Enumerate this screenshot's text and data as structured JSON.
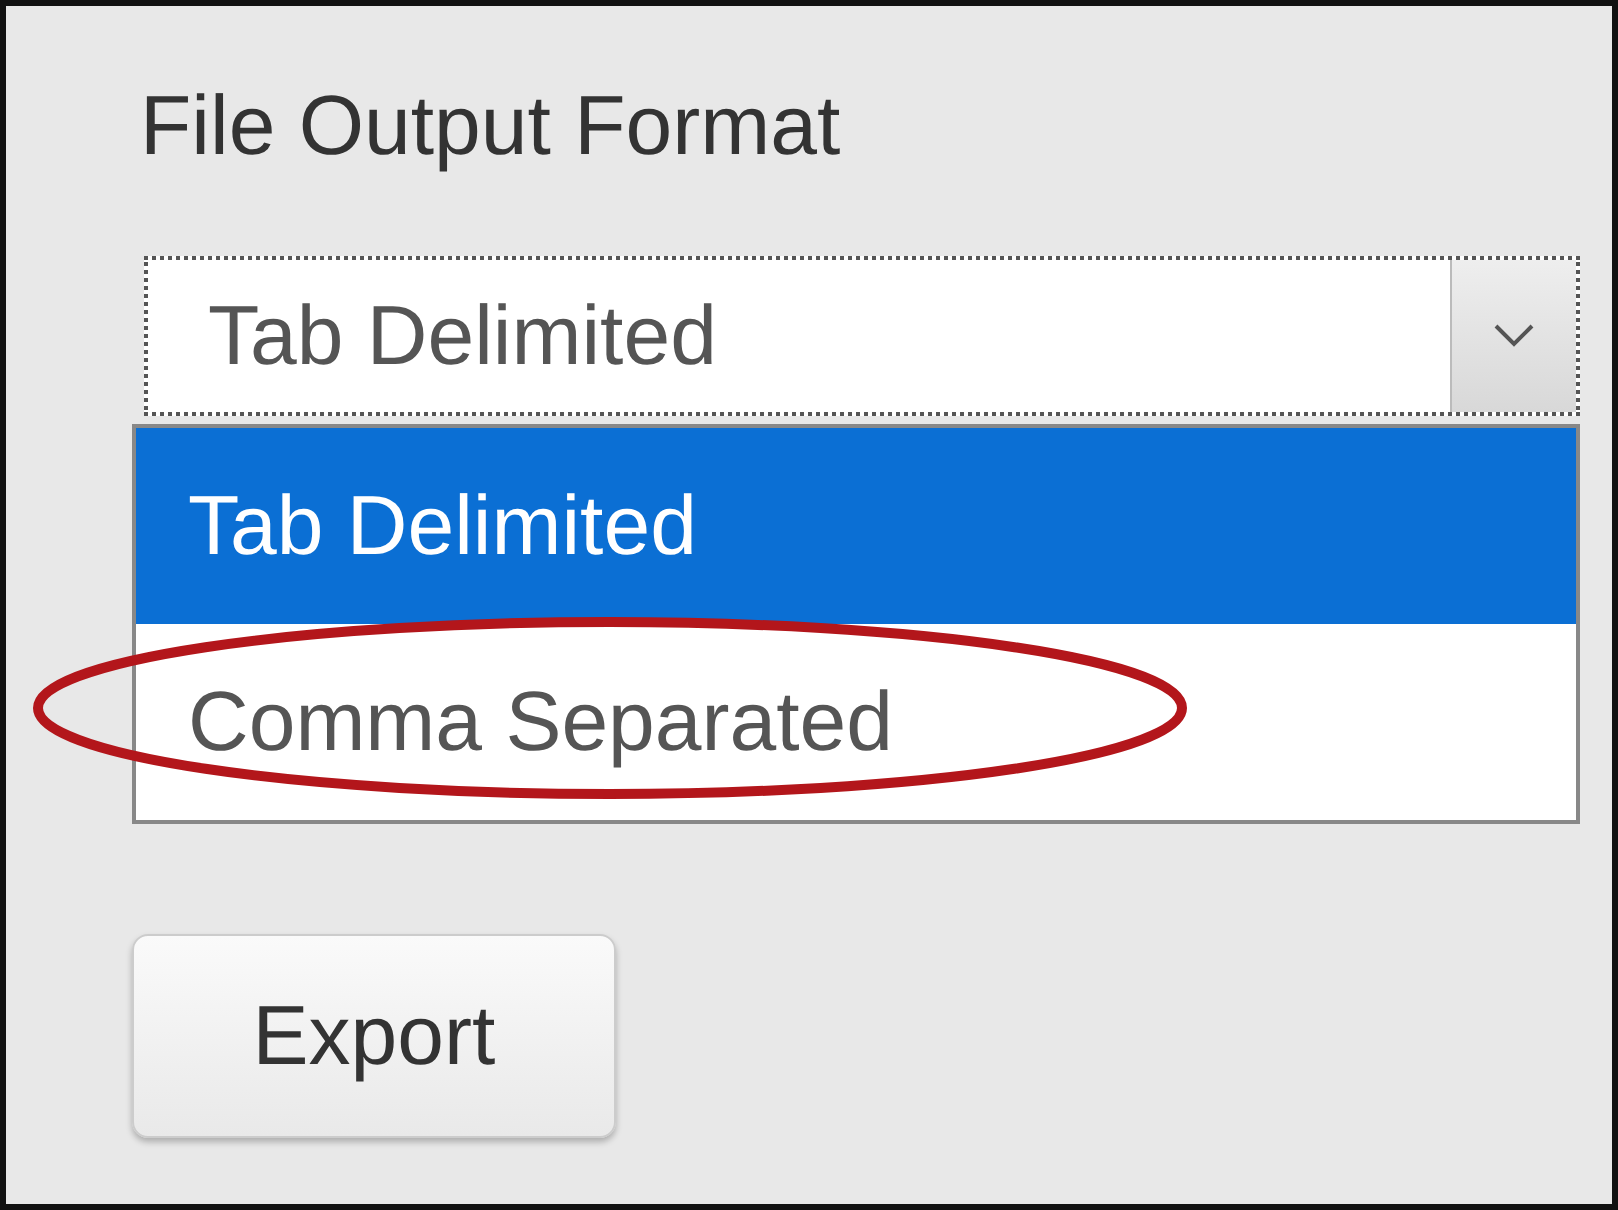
{
  "label": "File Output Format",
  "dropdown": {
    "value": "Tab Delimited",
    "expanded": true,
    "options": [
      {
        "label": "Tab Delimited",
        "selected": true
      },
      {
        "label": "Comma Separated",
        "selected": false
      }
    ]
  },
  "buttons": [
    "Export"
  ]
}
